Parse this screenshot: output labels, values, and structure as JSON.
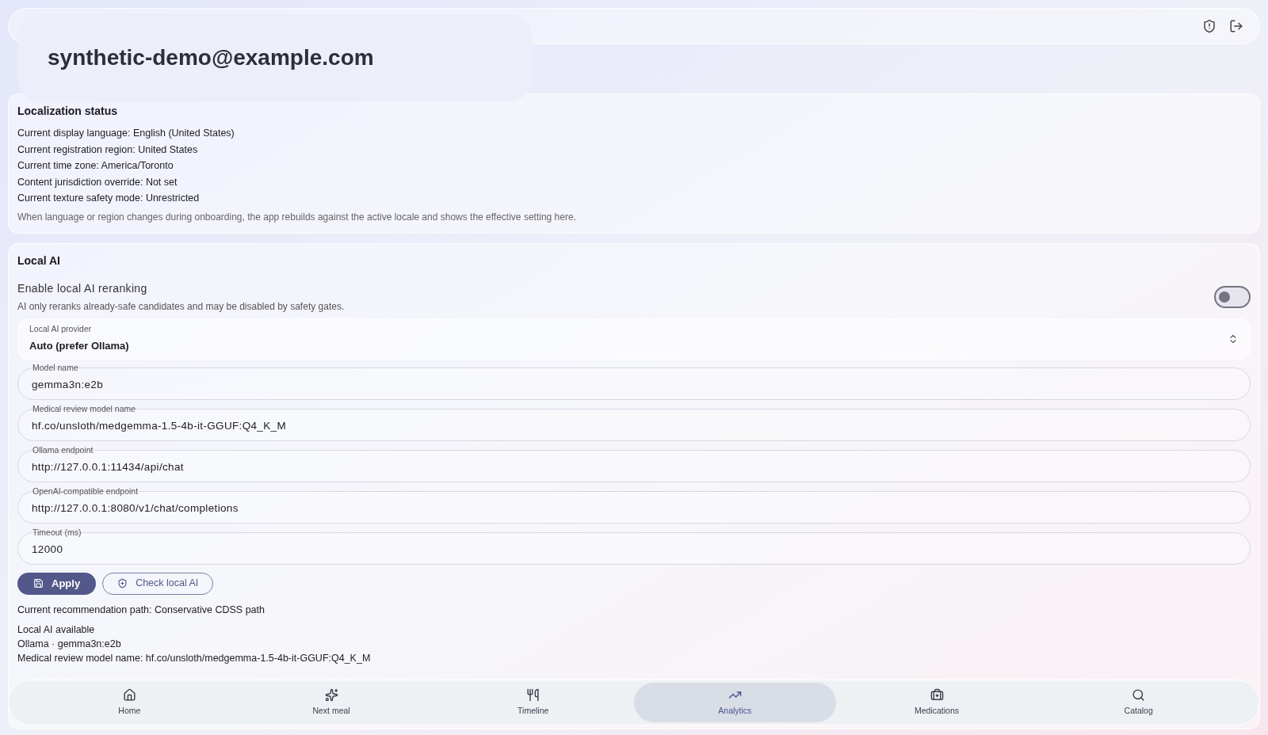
{
  "account_overlay": {
    "email": "synthetic-demo@example.com"
  },
  "localization": {
    "title": "Localization status",
    "lines": [
      "Current display language: English (United States)",
      "Current registration region: United States",
      "Current time zone: America/Toronto",
      "Content jurisdiction override: Not set",
      "Current texture safety mode: Unrestricted"
    ],
    "note": "When language or region changes during onboarding, the app rebuilds against the active locale and shows the effective setting here."
  },
  "local_ai": {
    "title": "Local AI",
    "toggle": {
      "label": "Enable local AI reranking",
      "description": "AI only reranks already-safe candidates and may be disabled by safety gates.",
      "on": false
    },
    "provider": {
      "label": "Local AI provider",
      "value": "Auto (prefer Ollama)"
    },
    "fields": [
      {
        "label": "Model name",
        "value": "gemma3n:e2b"
      },
      {
        "label": "Medical review model name",
        "value": "hf.co/unsloth/medgemma-1.5-4b-it-GGUF:Q4_K_M"
      },
      {
        "label": "Ollama endpoint",
        "value": "http://127.0.0.1:11434/api/chat"
      },
      {
        "label": "OpenAI-compatible endpoint",
        "value": "http://127.0.0.1:8080/v1/chat/completions"
      },
      {
        "label": "Timeout (ms)",
        "value": "12000"
      }
    ],
    "buttons": [
      {
        "kind": "primary",
        "label": "Apply"
      },
      {
        "kind": "outline",
        "label": "Check local AI"
      }
    ],
    "path": "Current recommendation path: Conservative CDSS path",
    "status_lines": [
      "Local AI available",
      "Ollama · gemma3n:e2b",
      "Medical review model name: hf.co/unsloth/medgemma-1.5-4b-it-GGUF:Q4_K_M"
    ]
  },
  "nav": [
    {
      "label": "Home",
      "kind": "home",
      "selected": false
    },
    {
      "label": "Next meal",
      "kind": "suggest",
      "selected": false
    },
    {
      "label": "Timeline",
      "kind": "meals",
      "selected": false
    },
    {
      "label": "Analytics",
      "kind": "trends",
      "selected": true
    },
    {
      "label": "Medications",
      "kind": "medicine",
      "selected": false
    },
    {
      "label": "Catalog",
      "kind": "search",
      "selected": false
    }
  ]
}
